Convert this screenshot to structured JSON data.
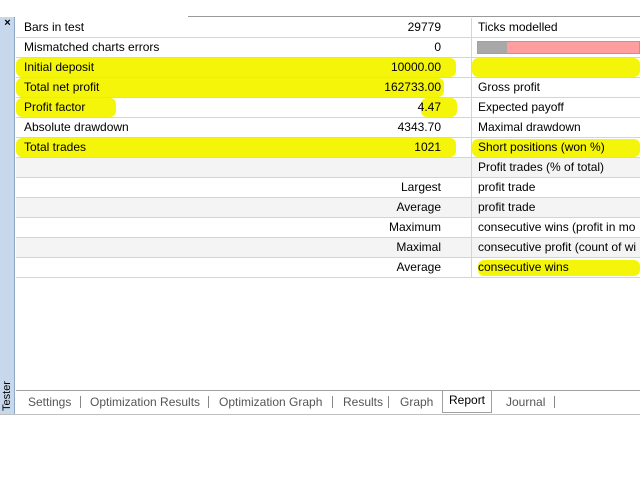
{
  "window": {
    "side_title": "Tester",
    "close_glyph": "×"
  },
  "rows": [
    {
      "label": "Bars in test",
      "value": "29779",
      "right": "Ticks modelled"
    },
    {
      "label": "Mismatched charts errors",
      "value": "0",
      "right": ""
    },
    {
      "label": "Initial deposit",
      "value": "10000.00",
      "right": ""
    },
    {
      "label": "Total net profit",
      "value": "162733.00",
      "right": "Gross profit"
    },
    {
      "label": "Profit factor",
      "value": "4.47",
      "right": "Expected payoff"
    },
    {
      "label": "Absolute drawdown",
      "value": "4343.70",
      "right": "Maximal drawdown"
    },
    {
      "label": "Total trades",
      "value": "1021",
      "right": "Short positions (won %)"
    },
    {
      "label": "",
      "value": "",
      "right": "Profit trades (% of total)"
    },
    {
      "label": "",
      "value": "Largest",
      "right": "profit trade"
    },
    {
      "label": "",
      "value": "Average",
      "right": "profit trade"
    },
    {
      "label": "",
      "value": "Maximum",
      "right": "consecutive wins (profit in mo"
    },
    {
      "label": "",
      "value": "Maximal",
      "right": "consecutive profit (count of wi"
    },
    {
      "label": "",
      "value": "Average",
      "right": "consecutive wins"
    }
  ],
  "modelling_quality": {
    "fraction": 0.18,
    "good_color": "#a8a8a8",
    "bad_color": "#ff9e9e"
  },
  "highlight_color": "#f5f50a",
  "tabs": [
    {
      "label": "Settings"
    },
    {
      "label": "Optimization Results"
    },
    {
      "label": "Optimization Graph"
    },
    {
      "label": "Results"
    },
    {
      "label": "Graph"
    },
    {
      "label": "Report"
    },
    {
      "label": "Journal"
    }
  ],
  "active_tab": "Report"
}
